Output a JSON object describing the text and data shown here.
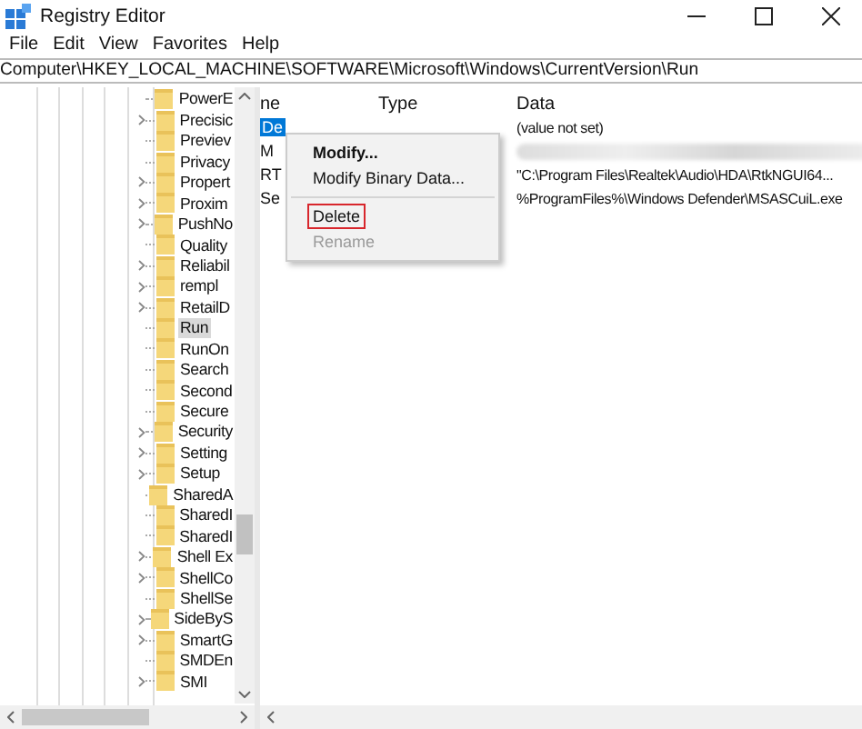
{
  "window": {
    "title": "Registry Editor"
  },
  "menu": [
    "File",
    "Edit",
    "View",
    "Favorites",
    "Help"
  ],
  "address": "Computer\\HKEY_LOCAL_MACHINE\\SOFTWARE\\Microsoft\\Windows\\CurrentVersion\\Run",
  "tree": [
    {
      "label": "PowerE",
      "expandable": false,
      "selected": false
    },
    {
      "label": "Precisic",
      "expandable": true,
      "selected": false
    },
    {
      "label": "Previev",
      "expandable": false,
      "selected": false
    },
    {
      "label": "Privacy",
      "expandable": false,
      "selected": false
    },
    {
      "label": "Propert",
      "expandable": true,
      "selected": false
    },
    {
      "label": "Proxim",
      "expandable": true,
      "selected": false
    },
    {
      "label": "PushNo",
      "expandable": true,
      "selected": false
    },
    {
      "label": "Quality",
      "expandable": false,
      "selected": false
    },
    {
      "label": "Reliabil",
      "expandable": true,
      "selected": false
    },
    {
      "label": "rempl",
      "expandable": true,
      "selected": false
    },
    {
      "label": "RetailD",
      "expandable": true,
      "selected": false
    },
    {
      "label": "Run",
      "expandable": false,
      "selected": true
    },
    {
      "label": "RunOn",
      "expandable": false,
      "selected": false
    },
    {
      "label": "Search",
      "expandable": false,
      "selected": false
    },
    {
      "label": "Second",
      "expandable": false,
      "selected": false
    },
    {
      "label": "Secure",
      "expandable": false,
      "selected": false
    },
    {
      "label": "Security",
      "expandable": true,
      "selected": false
    },
    {
      "label": "Setting",
      "expandable": true,
      "selected": false
    },
    {
      "label": "Setup",
      "expandable": true,
      "selected": false
    },
    {
      "label": "SharedA",
      "expandable": false,
      "selected": false
    },
    {
      "label": "SharedI",
      "expandable": false,
      "selected": false
    },
    {
      "label": "SharedI",
      "expandable": false,
      "selected": false
    },
    {
      "label": "Shell Ex",
      "expandable": true,
      "selected": false
    },
    {
      "label": "ShellCo",
      "expandable": true,
      "selected": false
    },
    {
      "label": "ShellSe",
      "expandable": false,
      "selected": false
    },
    {
      "label": "SideByS",
      "expandable": true,
      "selected": false
    },
    {
      "label": "SmartG",
      "expandable": true,
      "selected": false
    },
    {
      "label": "SMDEn",
      "expandable": false,
      "selected": false
    },
    {
      "label": "SMI",
      "expandable": true,
      "selected": false
    }
  ],
  "columns": [
    "ne",
    "Type",
    "Data"
  ],
  "values": [
    {
      "name": "De",
      "data": "(value not set)",
      "selected": true,
      "blurred": false
    },
    {
      "name": "M",
      "selected": false,
      "blurred": true
    },
    {
      "name": "RT",
      "data": "\"C:\\Program Files\\Realtek\\Audio\\HDA\\RtkNGUI64...",
      "selected": false,
      "blurred": false
    },
    {
      "name": "Se",
      "data": "%ProgramFiles%\\Windows Defender\\MSASCuiL.exe",
      "selected": false,
      "blurred": false
    }
  ],
  "context_menu": [
    {
      "label": "Modify...",
      "kind": "default",
      "disabled": false,
      "highlighted": false
    },
    {
      "label": "Modify Binary Data...",
      "kind": "item",
      "disabled": false,
      "highlighted": false
    },
    {
      "kind": "separator"
    },
    {
      "label": "Delete",
      "kind": "item",
      "disabled": false,
      "highlighted": true
    },
    {
      "label": "Rename",
      "kind": "item",
      "disabled": true,
      "highlighted": false
    }
  ]
}
